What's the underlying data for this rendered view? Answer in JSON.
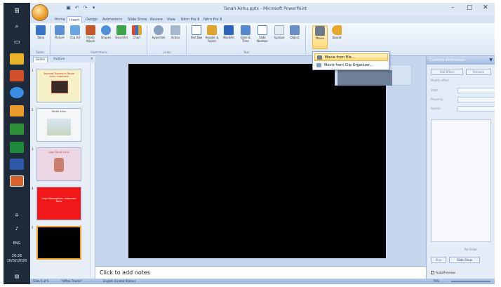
{
  "window": {
    "title": "Tanah Airku.pptx - Microsoft PowerPoint",
    "minimize": "–",
    "maximize": "▢",
    "close": "✕"
  },
  "ribbon": {
    "tabs": [
      "Home",
      "Insert",
      "Design",
      "Animations",
      "Slide Show",
      "Review",
      "View",
      "Nitro Pro 8",
      "Nitro Pro 8"
    ],
    "active_tab": "Insert",
    "buttons": [
      {
        "label": "Table",
        "icon": "table-icon",
        "color": "#3a72c4"
      },
      {
        "label": "Picture",
        "icon": "picture-icon",
        "color": "#5b8fd1"
      },
      {
        "label": "Clip Art",
        "icon": "clip-art-icon",
        "color": "#6aa6e0"
      },
      {
        "label": "Photo Album",
        "icon": "photo-album-icon",
        "color": "#c2572a"
      },
      {
        "label": "Shapes",
        "icon": "shapes-icon",
        "color": "#4f8fd8"
      },
      {
        "label": "SmartArt",
        "icon": "smartart-icon",
        "color": "#3fa34d"
      },
      {
        "label": "Chart",
        "icon": "chart-icon",
        "color": "#d84a2a"
      },
      {
        "label": "Hyperlink",
        "icon": "hyperlink-icon",
        "color": "#8aa0bf"
      },
      {
        "label": "Action",
        "icon": "action-icon",
        "color": "#a8b8cf"
      },
      {
        "label": "Text Box",
        "icon": "text-box-icon",
        "color": "#4e7cc0"
      },
      {
        "label": "Header & Footer",
        "icon": "header-footer-icon",
        "color": "#e0a530"
      },
      {
        "label": "WordArt",
        "icon": "wordart-icon",
        "color": "#2d64b8"
      },
      {
        "label": "Date & Time",
        "icon": "date-time-icon",
        "color": "#5588cc"
      },
      {
        "label": "Slide Number",
        "icon": "slide-number-icon",
        "color": "#4a7ec6"
      },
      {
        "label": "Symbol",
        "icon": "symbol-icon",
        "color": "#9aaac2"
      },
      {
        "label": "Object",
        "icon": "object-icon",
        "color": "#6b8fc4"
      },
      {
        "label": "Movie",
        "icon": "movie-icon",
        "color": "#6c7a8c"
      },
      {
        "label": "Sound",
        "icon": "sound-icon",
        "color": "#e3a62f"
      }
    ],
    "groups": [
      "Tables",
      "Illustrations",
      "Links",
      "Text"
    ]
  },
  "menu": {
    "items": [
      "Movie from File...",
      "Movie from Clip Organizer..."
    ]
  },
  "slides_pane": {
    "tabs": [
      "Slides",
      "Outline"
    ],
    "close": "×",
    "thumbnails": [
      {
        "num": "1",
        "title": "Selamat Datang di Tanah Airku Indonesia",
        "bg": "#f6f0c6"
      },
      {
        "num": "2",
        "title": "Tanah Airku",
        "bg": "#f4f6f8"
      },
      {
        "num": "3",
        "title": "Lagu Tanah Airku",
        "bg": "#eed7e4"
      },
      {
        "num": "4",
        "title": "Lagu Kebangsaan Indonesia Raya",
        "bg": "#f01818"
      },
      {
        "num": "5",
        "title": "",
        "bg": "#000000"
      }
    ]
  },
  "notes": {
    "placeholder": "Click to add notes"
  },
  "task_pane": {
    "title": "Custom Animation",
    "add_effect": "Add Effect",
    "remove": "Remove",
    "modify": "Modify effect",
    "start_label": "Start:",
    "property_label": "Property:",
    "speed_label": "Speed:",
    "reorder": "Re-Order",
    "play": "Play",
    "slide_show": "Slide Show",
    "autopreview": "AutoPreview"
  },
  "status_bar": {
    "slide_info": "Slide 5 of 5",
    "theme": "\"Office Theme\"",
    "language": "English (United States)",
    "zoom": "79%"
  },
  "taskbar": {
    "lang": "ENG",
    "time": "20:26",
    "date": "10/02/2020"
  }
}
